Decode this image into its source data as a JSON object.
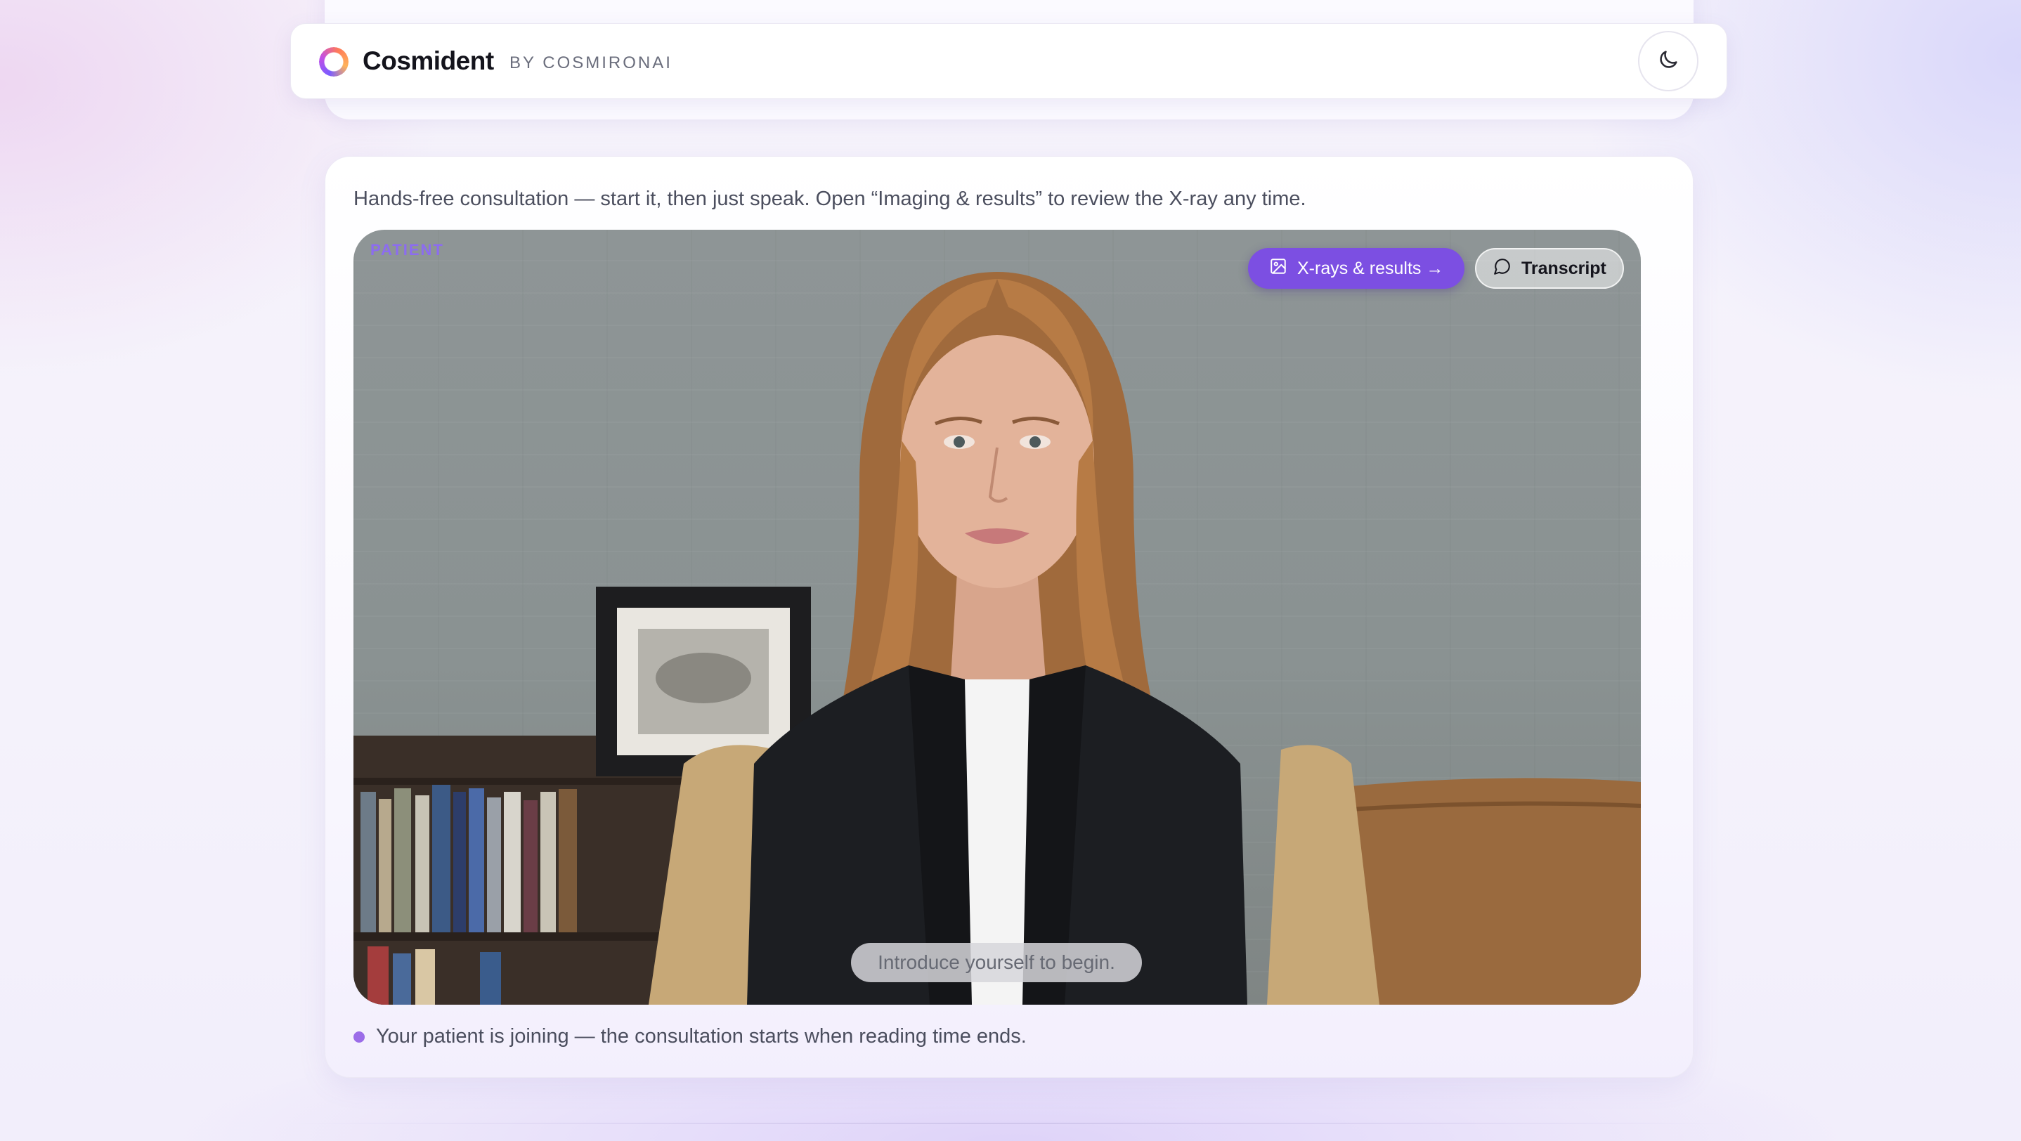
{
  "header": {
    "brand": "Cosmident",
    "byline": "BY COSMIRONAI",
    "logo_icon": "ring-logo-icon",
    "theme_icon": "moon-icon"
  },
  "consultation": {
    "intro": "Hands-free consultation — start it, then just speak. Open “Imaging & results” to review the X-ray any time.",
    "video": {
      "speaker_tag": "PATIENT",
      "xray_button": "X-rays & results →",
      "xray_icon": "image-icon",
      "transcript_button": "Transcript",
      "transcript_icon": "chat-bubble-icon",
      "caption": "Introduce yourself to begin."
    },
    "status": "Your patient is joining — the consultation starts when reading time ends."
  },
  "colors": {
    "accent": "#7c4fe2",
    "primary_button": "#5b3cf0",
    "status_dot": "#9b6ce8"
  }
}
